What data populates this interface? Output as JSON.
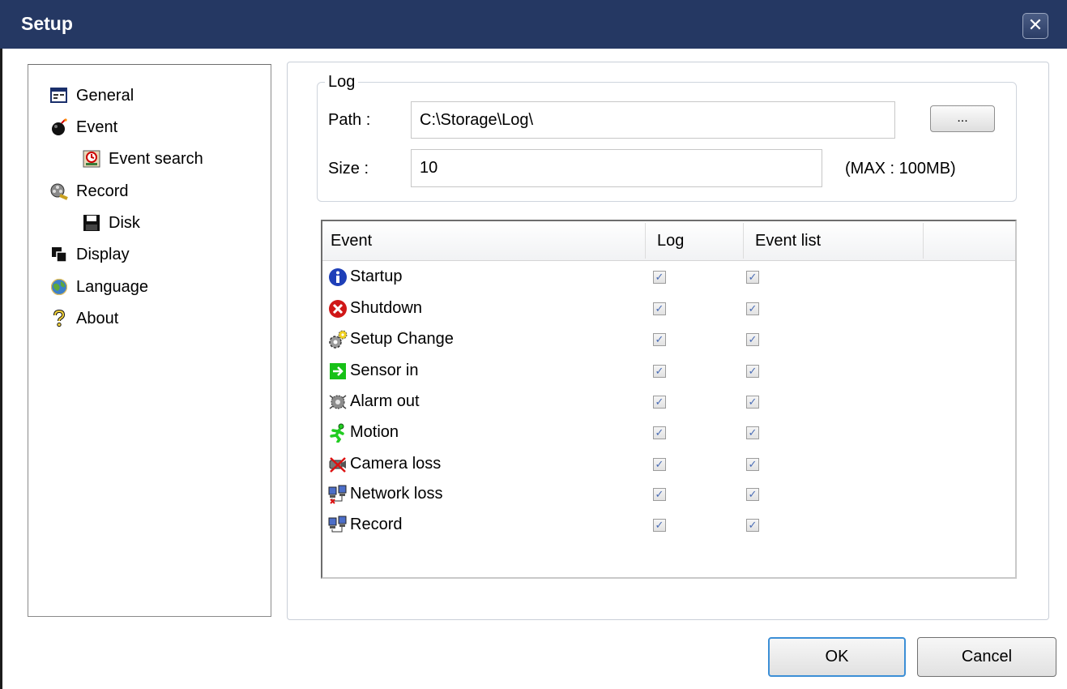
{
  "window": {
    "title": "Setup",
    "close_label": "✕"
  },
  "nav": {
    "items": [
      {
        "label": "General",
        "icon": "general-icon"
      },
      {
        "label": "Event",
        "icon": "bomb-icon"
      },
      {
        "label": "Event search",
        "icon": "event-search-icon"
      },
      {
        "label": "Record",
        "icon": "film-reel-icon"
      },
      {
        "label": "Disk",
        "icon": "floppy-disk-icon"
      },
      {
        "label": "Display",
        "icon": "display-icon"
      },
      {
        "label": "Language",
        "icon": "globe-icon"
      },
      {
        "label": "About",
        "icon": "question-icon"
      }
    ]
  },
  "log": {
    "legend": "Log",
    "path_label": "Path :",
    "path_value": "C:\\Storage\\Log\\",
    "browse_label": "...",
    "size_label": "Size :",
    "size_value": "10",
    "max_note": "(MAX : 100MB)"
  },
  "table": {
    "columns": [
      "Event",
      "Log",
      "Event list"
    ],
    "rows": [
      {
        "label": "Startup",
        "icon": "info-icon",
        "log": true,
        "event_list": true
      },
      {
        "label": "Shutdown",
        "icon": "stop-icon",
        "log": true,
        "event_list": true
      },
      {
        "label": "Setup Change",
        "icon": "gears-icon",
        "log": true,
        "event_list": true
      },
      {
        "label": "Sensor in",
        "icon": "sensor-in-icon",
        "log": true,
        "event_list": true
      },
      {
        "label": "Alarm out",
        "icon": "alarm-out-icon",
        "log": true,
        "event_list": true
      },
      {
        "label": "Motion",
        "icon": "running-man-icon",
        "log": true,
        "event_list": true
      },
      {
        "label": "Camera loss",
        "icon": "camera-loss-icon",
        "log": true,
        "event_list": true
      },
      {
        "label": "Network loss",
        "icon": "network-loss-icon",
        "log": true,
        "event_list": true
      },
      {
        "label": "Record",
        "icon": "network-record-icon",
        "log": true,
        "event_list": true
      }
    ]
  },
  "buttons": {
    "ok": "OK",
    "cancel": "Cancel"
  },
  "colors": {
    "titlebar": "#253863",
    "checkmark": "#4a6cb5",
    "ok_border": "#3c8fd6"
  }
}
